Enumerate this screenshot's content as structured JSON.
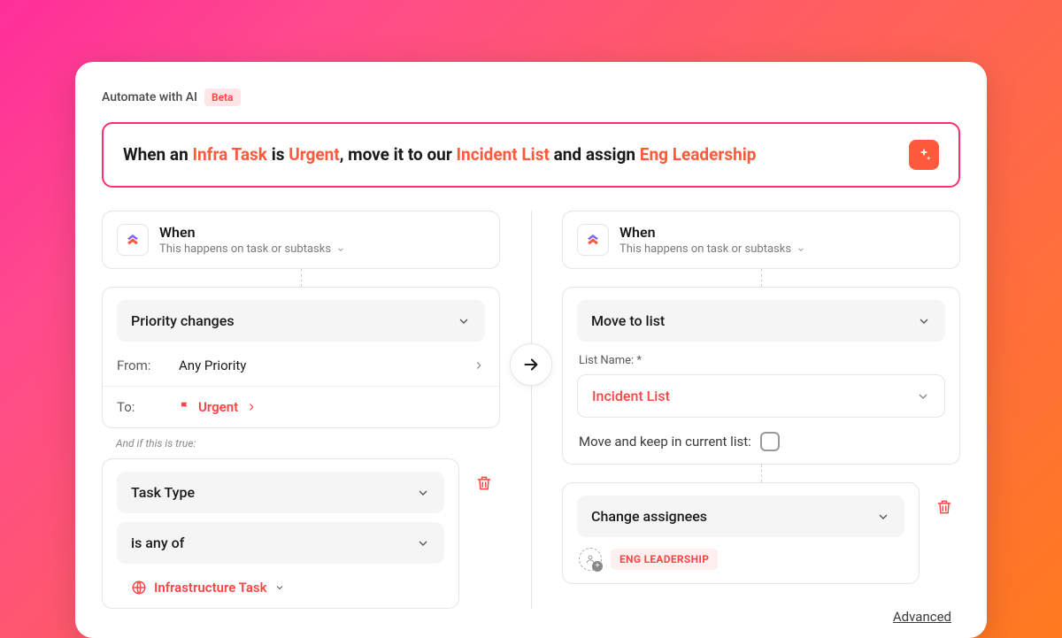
{
  "header": {
    "automate": "Automate with AI",
    "beta": "Beta"
  },
  "aiInput": {
    "segments": [
      {
        "t": "When an ",
        "hl": false
      },
      {
        "t": "Infra Task",
        "hl": true
      },
      {
        "t": " is ",
        "hl": false
      },
      {
        "t": "Urgent",
        "hl": true
      },
      {
        "t": ", move it to our ",
        "hl": false
      },
      {
        "t": "Incident List",
        "hl": true
      },
      {
        "t": " and assign ",
        "hl": false
      },
      {
        "t": "Eng Leadership",
        "hl": true
      }
    ]
  },
  "left": {
    "when": {
      "title": "When",
      "sub": "This happens on task or subtasks"
    },
    "trigger": {
      "label": "Priority changes",
      "fromLabel": "From:",
      "fromValue": "Any Priority",
      "toLabel": "To:",
      "toValue": "Urgent"
    },
    "andIf": "And if this is true:",
    "condition": {
      "field": "Task Type",
      "op": "is any of",
      "value": "Infrastructure Task"
    }
  },
  "right": {
    "when": {
      "title": "When",
      "sub": "This happens on task or subtasks"
    },
    "action1": {
      "label": "Move to list",
      "listLabel": "List Name: *",
      "listValue": "Incident List",
      "keepLabel": "Move and keep in current list:"
    },
    "action2": {
      "label": "Change assignees",
      "chip": "ENG LEADERSHIP"
    },
    "advanced": "Advanced"
  }
}
